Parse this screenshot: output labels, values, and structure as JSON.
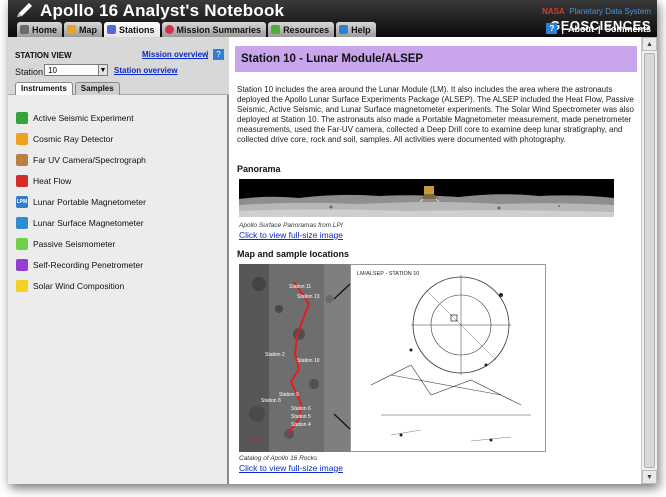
{
  "app": {
    "title": "Apollo 16 Analyst's Notebook",
    "brand_nasa": "NASA",
    "brand_pds": "Planetary Data System",
    "brand_geo": "GEOSCIENCES"
  },
  "nav_tabs": [
    {
      "label": "Home",
      "icon": "home-icon",
      "color": "#6a6a6a"
    },
    {
      "label": "Map",
      "icon": "map-icon",
      "color": "#e9a126"
    },
    {
      "label": "Stations",
      "icon": "stations-icon",
      "color": "#5668d8"
    },
    {
      "label": "Mission Summaries",
      "icon": "mission-icon",
      "color": "#d8304a"
    },
    {
      "label": "Resources",
      "icon": "resources-icon",
      "color": "#4fae3a"
    },
    {
      "label": "Help",
      "icon": "help-icon",
      "color": "#2e7fd8"
    }
  ],
  "header_links": {
    "help": "?",
    "about": "About",
    "comments": "Comments",
    "sep": "|"
  },
  "left_panel": {
    "station_view_label": "STATION VIEW",
    "mission_overview_link": "Mission overview",
    "separator": "|",
    "help": "?",
    "station_label": "Station",
    "station_value": "10",
    "station_overview_link": "Station overview",
    "subtabs": [
      "Instruments",
      "Samples"
    ],
    "instruments": [
      {
        "label": "Active Seismic Experiment",
        "icon": "active-seismic-icon",
        "color": "#37a23a"
      },
      {
        "label": "Cosmic Ray Detector",
        "icon": "cosmic-ray-icon",
        "color": "#f0a021"
      },
      {
        "label": "Far UV Camera/Spectrograph",
        "icon": "uv-camera-icon",
        "color": "#b88043"
      },
      {
        "label": "Heat Flow",
        "icon": "heat-flow-icon",
        "color": "#d72b2b"
      },
      {
        "label": "Lunar Portable Magnetometer",
        "icon": "lpm-icon",
        "color": "#2f7fce",
        "icon_text": "LPM"
      },
      {
        "label": "Lunar Surface Magnetometer",
        "icon": "lsm-icon",
        "color": "#2f8cd0"
      },
      {
        "label": "Passive Seismometer",
        "icon": "passive-seismic-icon",
        "color": "#6fd04a"
      },
      {
        "label": "Self-Recording Penetrometer",
        "icon": "penetrometer-icon",
        "color": "#9140d0"
      },
      {
        "label": "Solar Wind Composition",
        "icon": "solar-wind-icon",
        "color": "#f2d21d"
      }
    ]
  },
  "content": {
    "title": "Station 10 - Lunar Module/ALSEP",
    "description": "Station 10 includes the area around the Lunar Module (LM). It also includes the area where the astronauts deployed the Apollo Lunar Surface Experiments Package (ALSEP). The ALSEP included the Heat Flow, Passive Seismic, Active Seismic, and Lunar Surface magnetometer experiments. The Solar Wind Spectrometer was also deployed at Station 10. The astronauts also made a Portable Magnetometer measurement, made penetrometer measurements, used the Far-UV camera, collected a Deep Drill core to examine deep lunar stratigraphy, and collected drive core, rock and soil, samples. All activities were documented with photography.",
    "panorama_heading": "Panorama",
    "panorama_caption": "Apollo Surface Panoramas from LPI",
    "panorama_link": "Click to view full-size image",
    "map_heading": "Map and sample locations",
    "map_caption": "Catalog of Apollo 16 Rocks",
    "map_link": "Click to view full-size image",
    "map_labels": {
      "top": "Station 11",
      "s13": "Station 13",
      "s10": "Station 10",
      "s9": "Station 9",
      "s8": "Station 8",
      "s6": "Station 6",
      "s5": "Station 5",
      "s4": "Station 4",
      "s1": "Station 1",
      "s2": "Station 2"
    },
    "chart_label": "LM/ALSEP - STATION 10"
  }
}
